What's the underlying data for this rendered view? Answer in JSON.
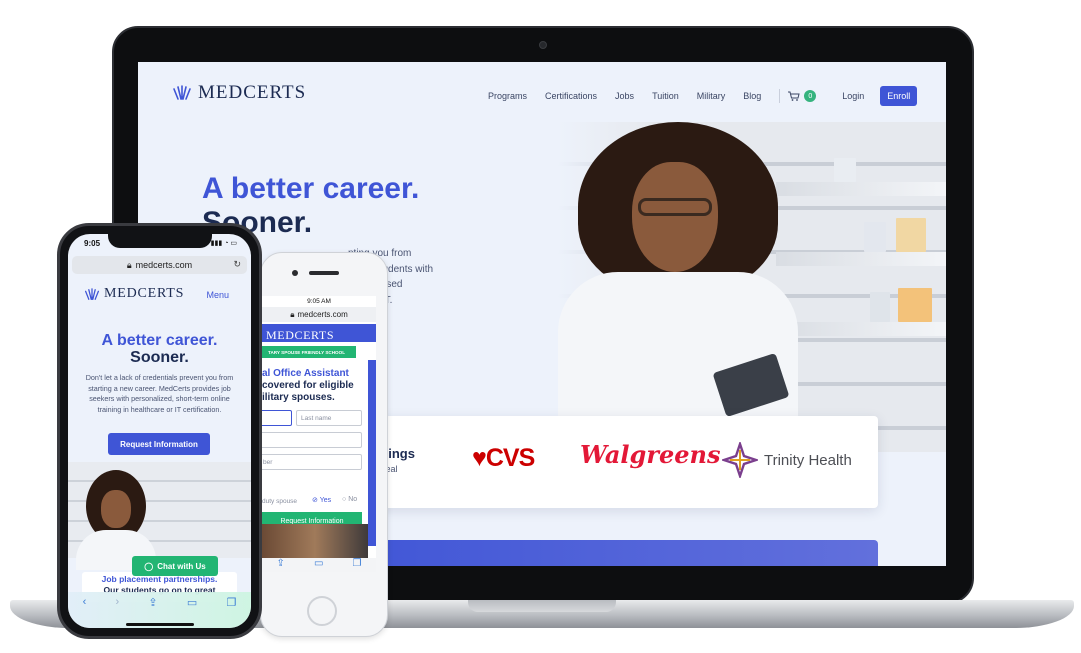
{
  "laptop": {
    "brand": "MEDCERTS",
    "nav": [
      "Programs",
      "Certifications",
      "Jobs",
      "Tuition",
      "Military",
      "Blog"
    ],
    "cart_count": "0",
    "login": "Login",
    "enroll": "Enroll",
    "headline_1": "A better career.",
    "headline_2": "Sooner.",
    "body_lines": [
      "nting you from",
      "ovide students with",
      "lation-based",
      "care or IT."
    ],
    "card": {
      "title_fragment": "s.",
      "subtitle_fragment": "t things",
      "text_fragment": "er real",
      "partners": [
        "CVS",
        "Walgreens",
        "Trinity Health"
      ]
    },
    "colors": {
      "primary": "#3f55d6",
      "green": "#35b37e"
    }
  },
  "phone_front": {
    "time": "9:05",
    "url": "medcerts.com",
    "brand": "MEDCERTS",
    "menu": "Menu",
    "headline_1": "A better career.",
    "headline_2": "Sooner.",
    "body": "Don't let a lack of credentials prevent you from starting a new career. MedCerts provides job seekers with personalized, short-term online training in healthcare or IT certification.",
    "cta": "Request Information",
    "chat": "Chat with Us",
    "section_title": "Job placement partnerships.",
    "section_sub": "Our students go on to great"
  },
  "phone_back": {
    "time": "9:05 AM",
    "url": "medcerts.com",
    "brand": "MEDCERTS",
    "badge": "TARY SPOUSE FRIENDLY SCHOOL",
    "title_1": "al Office Assistant",
    "title_2": " covered for eligible",
    "title_3": "ilitary spouses.",
    "last_name": "Last name",
    "phone_field": "ber",
    "radio_label": "duty spouse",
    "yes": "Yes",
    "no": "No",
    "cta": "Request Information"
  }
}
